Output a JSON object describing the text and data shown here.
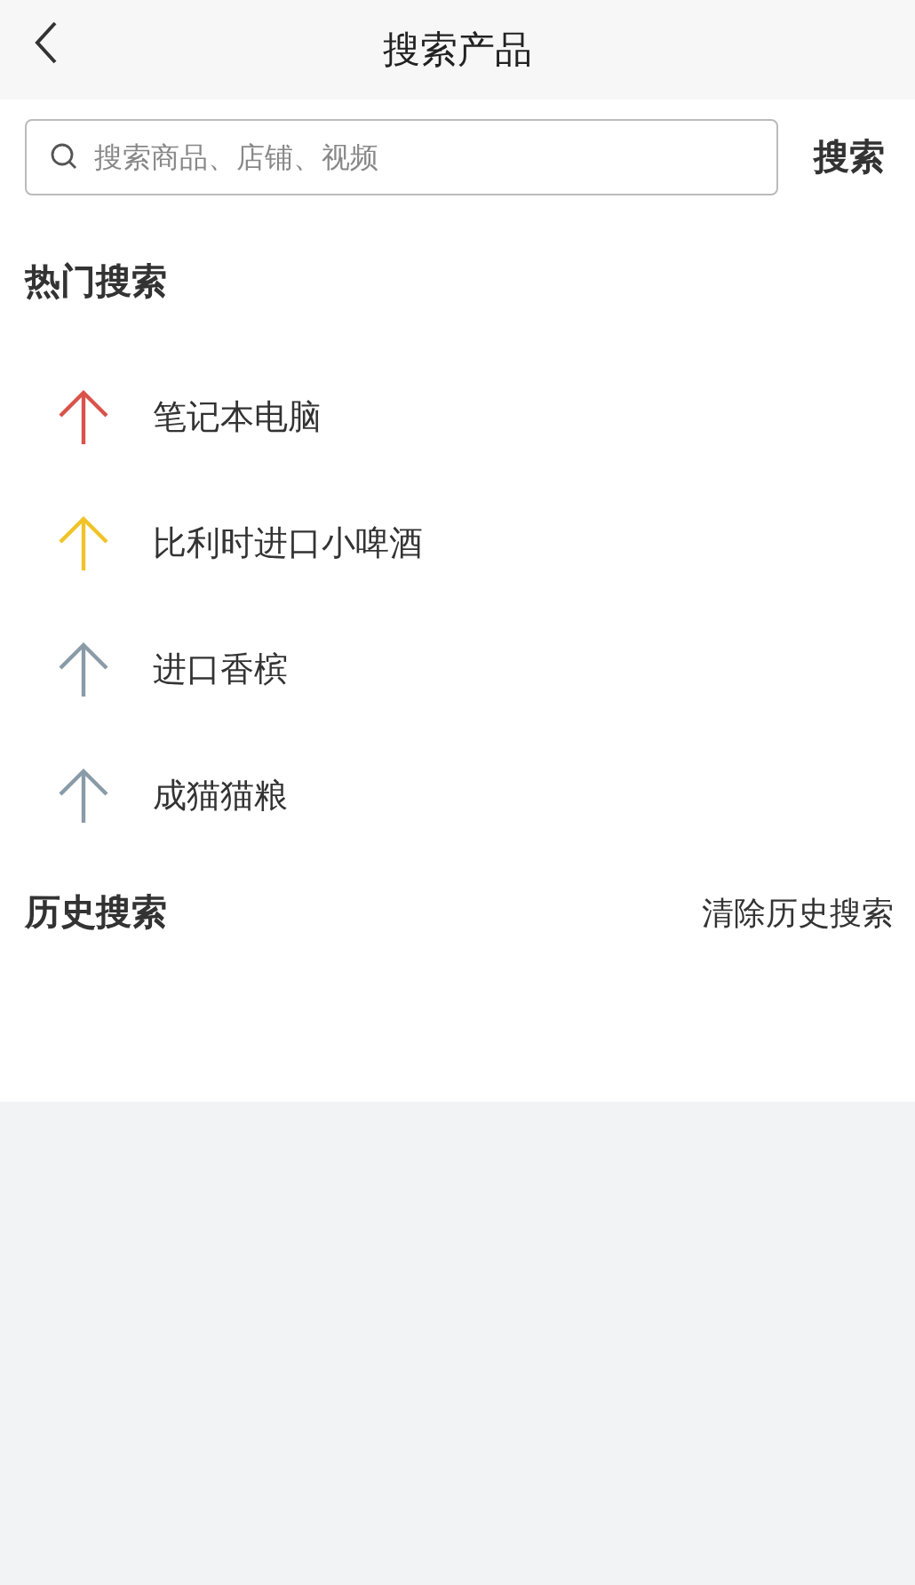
{
  "header": {
    "title": "搜索产品"
  },
  "search": {
    "placeholder": "搜索商品、店铺、视频",
    "button": "搜索"
  },
  "hot": {
    "title": "热门搜索",
    "items": [
      {
        "label": "笔记本电脑",
        "color": "#d9534a"
      },
      {
        "label": "比利时进口小啤酒",
        "color": "#f0c328"
      },
      {
        "label": "进口香槟",
        "color": "#8a9ba8"
      },
      {
        "label": "成猫猫粮",
        "color": "#8a9ba8"
      }
    ]
  },
  "history": {
    "title": "历史搜索",
    "clear": "清除历史搜索"
  }
}
